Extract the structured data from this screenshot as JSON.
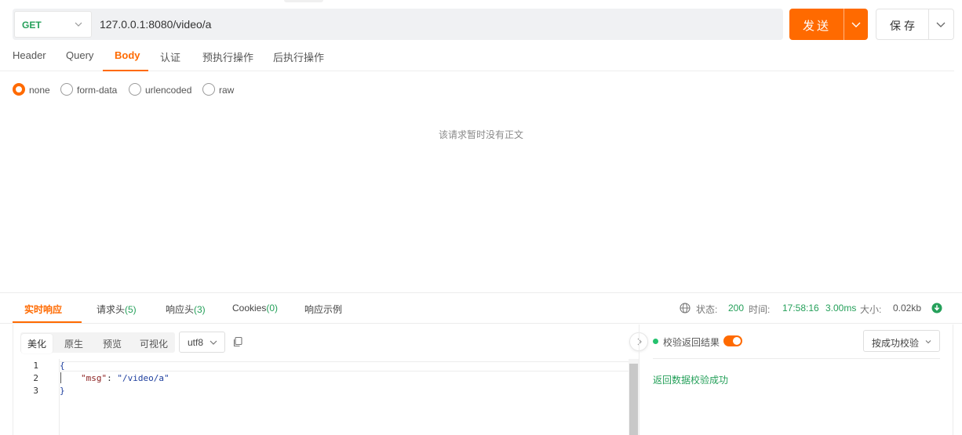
{
  "request": {
    "method": "GET",
    "url": "127.0.0.1:8080/video/a",
    "send_label": "发送",
    "save_label": "保存"
  },
  "request_tabs": [
    {
      "label": "Header"
    },
    {
      "label": "Query"
    },
    {
      "label": "Body",
      "active": true
    },
    {
      "label": "认证"
    },
    {
      "label": "预执行操作"
    },
    {
      "label": "后执行操作"
    }
  ],
  "body_types": [
    {
      "label": "none",
      "checked": true
    },
    {
      "label": "form-data"
    },
    {
      "label": "urlencoded"
    },
    {
      "label": "raw"
    }
  ],
  "body_empty_message": "该请求暂时没有正文",
  "response_tabs": [
    {
      "label": "实时响应",
      "active": true,
      "count": ""
    },
    {
      "label": "请求头",
      "count": "(5)"
    },
    {
      "label": "响应头",
      "count": "(3)"
    },
    {
      "label": "Cookies",
      "count": "(0)"
    },
    {
      "label": "响应示例",
      "count": ""
    }
  ],
  "status": {
    "status_label": "状态:",
    "status_code": "200",
    "time_label": "时间:",
    "time_value": "17:58:16",
    "duration": "3.00ms",
    "size_label": "大小:",
    "size_value": "0.02kb"
  },
  "format_modes": [
    {
      "label": "美化",
      "active": true
    },
    {
      "label": "原生"
    },
    {
      "label": "预览"
    },
    {
      "label": "可视化"
    }
  ],
  "encoding": "utf8",
  "code": {
    "line_numbers": [
      "1",
      "2",
      "3"
    ],
    "open_brace": "{",
    "key": "\"msg\"",
    "colon": ": ",
    "value": "\"/video/a\"",
    "close_brace": "}"
  },
  "validation": {
    "label": "校验返回结果",
    "enabled": true,
    "mode_label": "按成功校验",
    "result": "返回数据校验成功"
  },
  "colors": {
    "accent": "#ff6a00",
    "success": "#25a05a",
    "method_get": "#25a05a"
  },
  "icons": [
    "chevron-down-icon",
    "globe-icon",
    "download-icon",
    "copy-icon",
    "chevron-right-icon"
  ]
}
